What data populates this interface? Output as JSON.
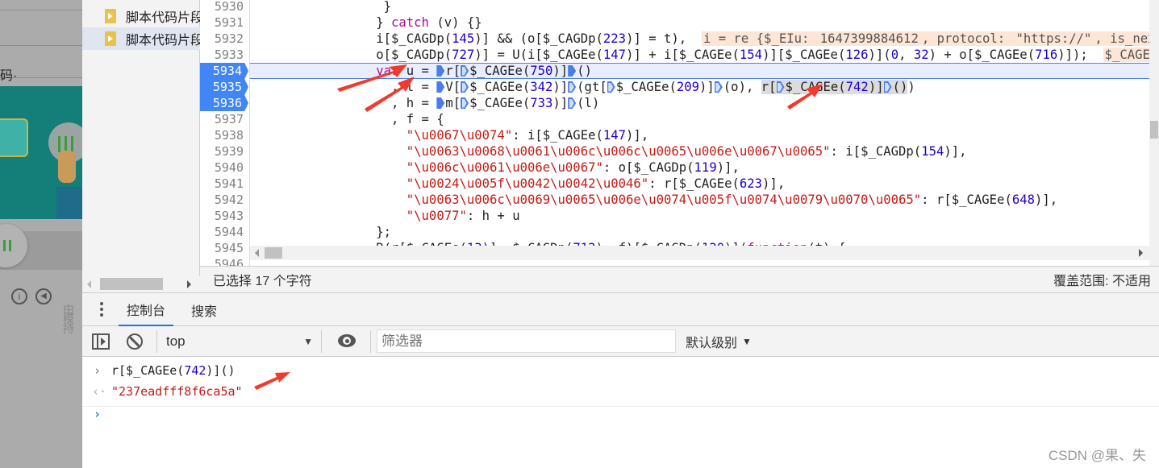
{
  "background_page": {
    "text_fragment": "码·",
    "side_text": "由模 持"
  },
  "sidebar": {
    "files": [
      {
        "label": "脚本代码片段",
        "selected": false
      },
      {
        "label": "脚本代码片段",
        "selected": true
      }
    ]
  },
  "editor": {
    "lines": [
      {
        "num": "5930",
        "breakpoint": false,
        "current": false,
        "tokens": [
          [
            "p",
            "                 }"
          ]
        ]
      },
      {
        "num": "5931",
        "breakpoint": false,
        "current": false,
        "tokens": [
          [
            "p",
            "                } "
          ],
          [
            "k",
            "catch"
          ],
          [
            "p",
            " (v) {}"
          ]
        ]
      },
      {
        "num": "5932",
        "breakpoint": false,
        "current": false,
        "tokens": [
          [
            "p",
            "                i[$_CAGDp("
          ],
          [
            "n",
            "145"
          ],
          [
            "p",
            ")] && (o[$_CAGDp("
          ],
          [
            "n",
            "223"
          ],
          [
            "p",
            ")] = t),  "
          ],
          [
            "iv",
            "i = re {$_EIu: "
          ],
          [
            "ivn",
            "1647399884612"
          ],
          [
            "iv",
            ", protocol: "
          ],
          [
            "ivs",
            "\"https://\""
          ],
          [
            "iv",
            ", is_next"
          ]
        ]
      },
      {
        "num": "5933",
        "breakpoint": false,
        "current": false,
        "tokens": [
          [
            "p",
            "                o[$_CAGDp("
          ],
          [
            "n",
            "727"
          ],
          [
            "p",
            ")] = U(i[$_CAGEe("
          ],
          [
            "n",
            "147"
          ],
          [
            "p",
            ")] + i[$_CAGEe("
          ],
          [
            "n",
            "154"
          ],
          [
            "p",
            ")][$_CAGEe("
          ],
          [
            "n",
            "126"
          ],
          [
            "p",
            ")]("
          ],
          [
            "n",
            "0"
          ],
          [
            "p",
            ", "
          ],
          [
            "n",
            "32"
          ],
          [
            "p",
            ") + o[$_CAGEe("
          ],
          [
            "n",
            "716"
          ],
          [
            "p",
            ")]);  "
          ],
          [
            "iv",
            "$_CAGEe"
          ]
        ]
      },
      {
        "num": "5934",
        "breakpoint": true,
        "current": true,
        "tokens": [
          [
            "p",
            "                "
          ],
          [
            "k",
            "var"
          ],
          [
            "p",
            " u = "
          ],
          [
            "m",
            ""
          ],
          [
            "p",
            "r["
          ],
          [
            "mo",
            ""
          ],
          [
            "p",
            "$_CAGEe("
          ],
          [
            "n",
            "750"
          ],
          [
            "p",
            ")]"
          ],
          [
            "m",
            ""
          ],
          [
            "p",
            "()"
          ]
        ]
      },
      {
        "num": "5935",
        "breakpoint": true,
        "current": false,
        "tokens": [
          [
            "p",
            "                  , l = "
          ],
          [
            "m",
            ""
          ],
          [
            "p",
            "V["
          ],
          [
            "mo",
            ""
          ],
          [
            "p",
            "$_CAGEe("
          ],
          [
            "n",
            "342"
          ],
          [
            "p",
            ")]"
          ],
          [
            "mo",
            ""
          ],
          [
            "p",
            "(gt["
          ],
          [
            "mo",
            ""
          ],
          [
            "p",
            "$_CAGEe("
          ],
          [
            "n",
            "209"
          ],
          [
            "p",
            ")]"
          ],
          [
            "mo",
            ""
          ],
          [
            "p",
            "(o), "
          ],
          [
            "sel",
            "r["
          ],
          [
            "selmo",
            ""
          ],
          [
            "sel",
            "$_CAGEe("
          ],
          [
            "seln",
            "742"
          ],
          [
            "sel",
            ")]"
          ],
          [
            "selmo",
            ""
          ],
          [
            "sel",
            "()"
          ],
          [
            "p",
            ")"
          ]
        ]
      },
      {
        "num": "5936",
        "breakpoint": true,
        "current": false,
        "tokens": [
          [
            "p",
            "                  , h = "
          ],
          [
            "m",
            ""
          ],
          [
            "p",
            "m["
          ],
          [
            "mo",
            ""
          ],
          [
            "p",
            "$_CAGEe("
          ],
          [
            "n",
            "733"
          ],
          [
            "p",
            ")]"
          ],
          [
            "mo",
            ""
          ],
          [
            "p",
            "(l)"
          ]
        ]
      },
      {
        "num": "5937",
        "breakpoint": false,
        "current": false,
        "tokens": [
          [
            "p",
            "                  , f = {"
          ]
        ]
      },
      {
        "num": "5938",
        "breakpoint": false,
        "current": false,
        "tokens": [
          [
            "p",
            "                    "
          ],
          [
            "s",
            "\"\\u0067\\u0074\""
          ],
          [
            "p",
            ": i[$_CAGEe("
          ],
          [
            "n",
            "147"
          ],
          [
            "p",
            ")],"
          ]
        ]
      },
      {
        "num": "5939",
        "breakpoint": false,
        "current": false,
        "tokens": [
          [
            "p",
            "                    "
          ],
          [
            "s",
            "\"\\u0063\\u0068\\u0061\\u006c\\u006c\\u0065\\u006e\\u0067\\u0065\""
          ],
          [
            "p",
            ": i[$_CAGDp("
          ],
          [
            "n",
            "154"
          ],
          [
            "p",
            ")],"
          ]
        ]
      },
      {
        "num": "5940",
        "breakpoint": false,
        "current": false,
        "tokens": [
          [
            "p",
            "                    "
          ],
          [
            "s",
            "\"\\u006c\\u0061\\u006e\\u0067\""
          ],
          [
            "p",
            ": o[$_CAGDp("
          ],
          [
            "n",
            "119"
          ],
          [
            "p",
            ")],"
          ]
        ]
      },
      {
        "num": "5941",
        "breakpoint": false,
        "current": false,
        "tokens": [
          [
            "p",
            "                    "
          ],
          [
            "s",
            "\"\\u0024\\u005f\\u0042\\u0042\\u0046\""
          ],
          [
            "p",
            ": r[$_CAGEe("
          ],
          [
            "n",
            "623"
          ],
          [
            "p",
            ")],"
          ]
        ]
      },
      {
        "num": "5942",
        "breakpoint": false,
        "current": false,
        "tokens": [
          [
            "p",
            "                    "
          ],
          [
            "s",
            "\"\\u0063\\u006c\\u0069\\u0065\\u006e\\u0074\\u005f\\u0074\\u0079\\u0070\\u0065\""
          ],
          [
            "p",
            ": r[$_CAGEe("
          ],
          [
            "n",
            "648"
          ],
          [
            "p",
            ")],"
          ]
        ]
      },
      {
        "num": "5943",
        "breakpoint": false,
        "current": false,
        "tokens": [
          [
            "p",
            "                    "
          ],
          [
            "s",
            "\"\\u0077\""
          ],
          [
            "p",
            ": h + u"
          ]
        ]
      },
      {
        "num": "5944",
        "breakpoint": false,
        "current": false,
        "tokens": [
          [
            "p",
            "                };"
          ]
        ]
      },
      {
        "num": "5945",
        "breakpoint": false,
        "current": false,
        "tokens": [
          [
            "p",
            "                R(r[$_CAGEe("
          ],
          [
            "n",
            "13"
          ],
          [
            "p",
            ")], $_CAGDp("
          ],
          [
            "n",
            "712"
          ],
          [
            "p",
            "), f)[$_CAGDp("
          ],
          [
            "n",
            "120"
          ],
          [
            "p",
            ")]("
          ],
          [
            "k",
            "function"
          ],
          [
            "p",
            "(t) {"
          ]
        ]
      },
      {
        "num": "5946",
        "breakpoint": false,
        "current": false,
        "tokens": [
          [
            "p",
            ""
          ]
        ]
      }
    ]
  },
  "status": {
    "selection": "已选择 17 个字符",
    "coverage": "覆盖范围: 不适用"
  },
  "drawer": {
    "tabs": [
      {
        "label": "控制台",
        "active": true
      },
      {
        "label": "搜索",
        "active": false
      }
    ]
  },
  "console_toolbar": {
    "context": "top",
    "filter_placeholder": "筛选器",
    "level": "默认级别"
  },
  "console": {
    "input": {
      "pre": "r[$_CAGEe(",
      "num": "742",
      "post": ")]()"
    },
    "result": "\"237eadfff8f6ca5a\""
  },
  "watermark": "CSDN @果、失",
  "colors": {
    "accent": "#1a73e8",
    "breakpoint": "#4285f4",
    "annotation_arrow": "#f03a2e"
  }
}
